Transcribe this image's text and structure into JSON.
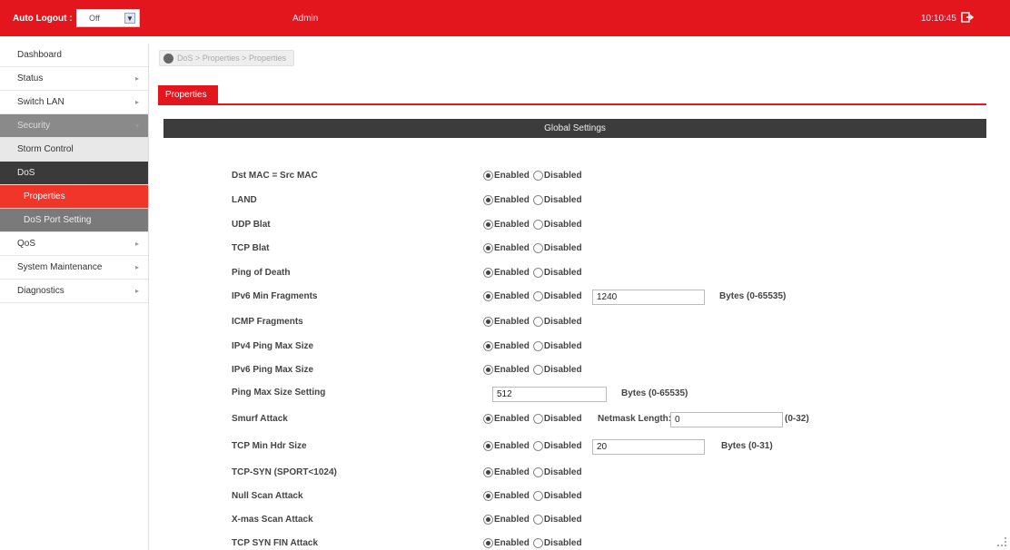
{
  "topbar": {
    "auto_logout_label": "Auto Logout :",
    "auto_logout_value": "Off",
    "user": "Admin",
    "clock": "10:10:45"
  },
  "sidebar": {
    "items": [
      {
        "label": "Dashboard"
      },
      {
        "label": "Status"
      },
      {
        "label": "Switch LAN"
      },
      {
        "label": "Security"
      },
      {
        "label": "Storm Control"
      },
      {
        "label": "DoS"
      },
      {
        "label": "Properties"
      },
      {
        "label": "DoS Port Setting"
      },
      {
        "label": "QoS"
      },
      {
        "label": "System Maintenance"
      },
      {
        "label": "Diagnostics"
      }
    ]
  },
  "breadcrumb": "DoS > Properties > Properties",
  "tab": "Properties",
  "section_title": "Global Settings",
  "enabled_label": "Enabled",
  "disabled_label": "Disabled",
  "rows": [
    {
      "label": "Dst MAC = Src MAC"
    },
    {
      "label": "LAND"
    },
    {
      "label": "UDP Blat"
    },
    {
      "label": "TCP Blat"
    },
    {
      "label": "Ping of Death"
    },
    {
      "label": "IPv6 Min Fragments",
      "value": "1240",
      "unit": "Bytes (0-65535)"
    },
    {
      "label": "ICMP Fragments"
    },
    {
      "label": "IPv4 Ping Max Size"
    },
    {
      "label": "IPv6 Ping Max Size"
    },
    {
      "label": "Ping Max Size Setting",
      "value": "512",
      "unit": "Bytes (0-65535)"
    },
    {
      "label": "Smurf Attack",
      "extra_label": "Netmask Length:",
      "value": "0",
      "unit": "(0-32)"
    },
    {
      "label": "TCP Min Hdr Size",
      "value": "20",
      "unit": "Bytes (0-31)"
    },
    {
      "label": "TCP-SYN (SPORT<1024)"
    },
    {
      "label": "Null Scan Attack"
    },
    {
      "label": "X-mas Scan Attack"
    },
    {
      "label": "TCP SYN FIN Attack"
    }
  ],
  "colors": {
    "brand_red": "#e3161d",
    "dark_header": "#3c3c3c"
  }
}
